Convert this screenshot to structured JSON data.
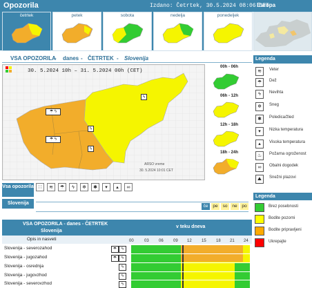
{
  "header": {
    "title": "Opozorila",
    "issued": "Izdano: Četrtek, 30.5.2024 08:06 CET",
    "region_tab": "Evropa"
  },
  "day_tabs": [
    {
      "label": "četrtek",
      "active": true
    },
    {
      "label": "petek",
      "active": false
    },
    {
      "label": "sobota",
      "active": false
    },
    {
      "label": "nedelja",
      "active": false
    },
    {
      "label": "ponedeljek",
      "active": false
    }
  ],
  "main": {
    "title": "VSA OPOZORILA - danes - ČETRTEK - Slovenija",
    "title_parts": {
      "a": "VSA OPOZORILA",
      "b": "danes",
      "c": "ČETRTEK",
      "d": "Slovenija"
    },
    "period": "30. 5.2024 10h  –  31. 5.2024 00h    (CET)",
    "credit_line1": "ARSO vreme",
    "credit_line2": "30. 5.2024  10:01 CET"
  },
  "time_slots": [
    {
      "label": "00h - 06h"
    },
    {
      "label": "06h - 12h"
    },
    {
      "label": "12h - 18h"
    },
    {
      "label": "18h - 24h"
    }
  ],
  "controls": {
    "vsa_label": "Vsa opozorila",
    "slovenija_label": "Slovenija",
    "days": [
      "če",
      "pe",
      "so",
      "ne",
      "po"
    ]
  },
  "table": {
    "title": "VSA OPOZORILA - danes - ČETRTEK",
    "col_left": "Slovenija",
    "col_right": "v teku dneva",
    "sub_left": "Opis in nasveti",
    "hours": [
      "00",
      "03",
      "06",
      "09",
      "12",
      "15",
      "18",
      "21",
      "24"
    ],
    "rows": [
      "Slovenija - severozahod",
      "Slovenija - jugozahod",
      "Slovenija - osrednja",
      "Slovenija - jugovzhod",
      "Slovenija - severovzhod"
    ]
  },
  "legend": {
    "title": "Legenda",
    "items": [
      {
        "label": "Veter",
        "icon": "wind-icon"
      },
      {
        "label": "Dež",
        "icon": "rain-icon"
      },
      {
        "label": "Nevihta",
        "icon": "thunderstorm-icon"
      },
      {
        "label": "Sneg",
        "icon": "snow-icon"
      },
      {
        "label": "Poledica/žled",
        "icon": "ice-icon"
      },
      {
        "label": "Nizka temperatura",
        "icon": "low-temp-icon"
      },
      {
        "label": "Visoka temperatura",
        "icon": "high-temp-icon"
      },
      {
        "label": "Požarna ogroženost",
        "icon": "fire-icon"
      },
      {
        "label": "Obalni dogodek",
        "icon": "coastal-icon"
      },
      {
        "label": "Snežni plazovi",
        "icon": "avalanche-icon"
      }
    ]
  },
  "legend2": {
    "title": "Legenda",
    "levels": [
      {
        "label": "Brez posebnosti",
        "color": "#33cc33"
      },
      {
        "label": "Bodite pozorni",
        "color": "#ffff00"
      },
      {
        "label": "Bodite pripravljeni",
        "color": "#ffaa00"
      },
      {
        "label": "Ukrepajte",
        "color": "#ff0000"
      }
    ]
  },
  "colors": {
    "green": "#33cc33",
    "yellow": "#f5f500",
    "orange": "#f2ad2b",
    "header_blue": "#3d86ad"
  }
}
